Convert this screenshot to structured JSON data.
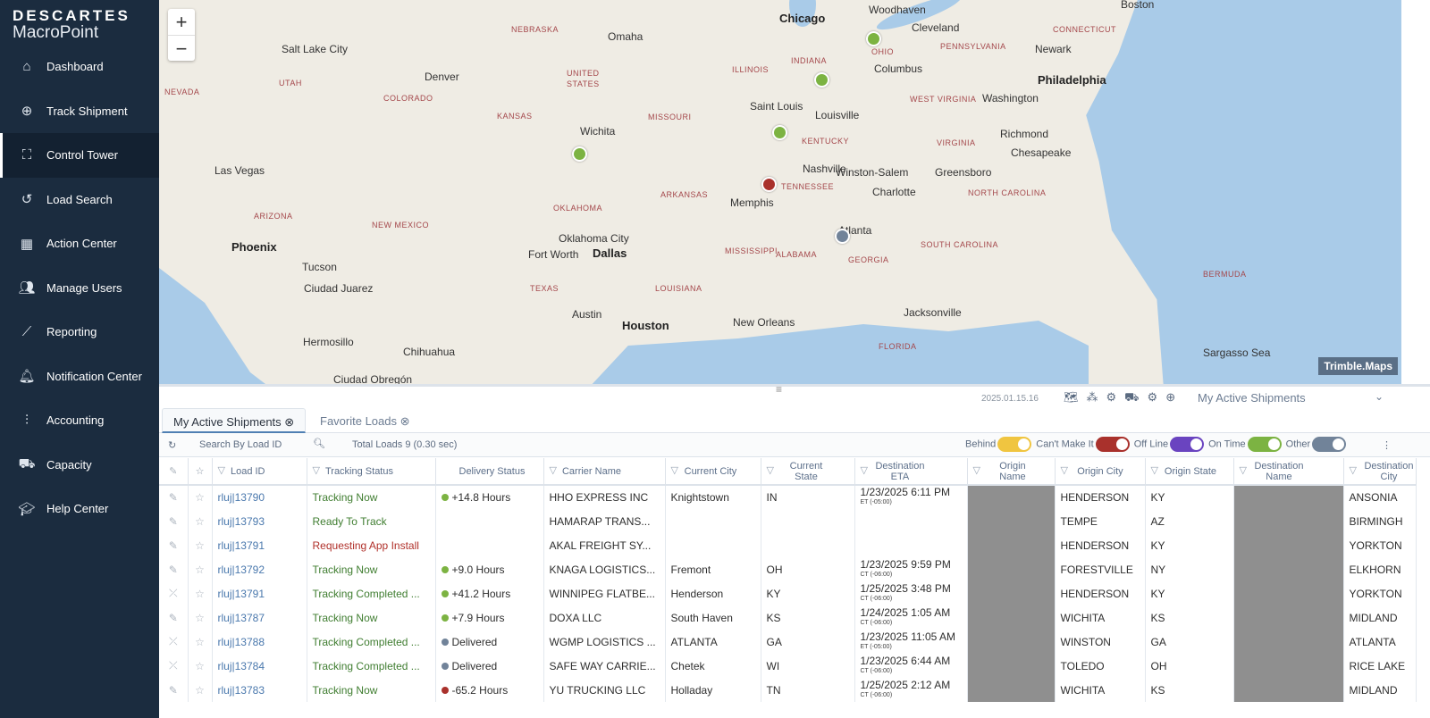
{
  "brand": {
    "line1": "DESCARTES",
    "line2": "MacroPoint"
  },
  "sidebar": {
    "items": [
      {
        "label": "Dashboard",
        "icon": "home-icon"
      },
      {
        "label": "Track Shipment",
        "icon": "plus-circle-icon"
      },
      {
        "label": "Control Tower",
        "icon": "binoculars-icon",
        "active": true
      },
      {
        "label": "Load Search",
        "icon": "history-icon"
      },
      {
        "label": "Action Center",
        "icon": "table-icon"
      },
      {
        "label": "Manage Users",
        "icon": "users-icon"
      },
      {
        "label": "Reporting",
        "icon": "chart-line-icon"
      },
      {
        "label": "Notification Center",
        "icon": "bell-icon"
      },
      {
        "label": "Accounting",
        "icon": "sliders-icon"
      },
      {
        "label": "Capacity",
        "icon": "truck-icon"
      },
      {
        "label": "Help Center",
        "icon": "graduation-cap-icon"
      }
    ]
  },
  "map": {
    "zoom_in": "+",
    "zoom_out": "−",
    "attribution": "Trimble.Maps",
    "labels": [
      "Chicago",
      "Woodhaven",
      "Cleveland",
      "Boston",
      "Columbus",
      "Philadelphia",
      "Washington",
      "Richmond",
      "Chesapeake",
      "Salt Lake City",
      "Denver",
      "Omaha",
      "UNITED",
      "STATES",
      "Wichita",
      "Saint Louis",
      "Louisville",
      "Nashville",
      "Winston-Salem",
      "Greensboro",
      "Charlotte",
      "Las Vegas",
      "Oklahoma City",
      "Memphis",
      "Atlanta",
      "Phoenix",
      "Fort Worth",
      "Dallas",
      "Tucson",
      "Ciudad Juarez",
      "Austin",
      "Houston",
      "New Orleans",
      "Jacksonville",
      "Hermosillo",
      "Chihuahua",
      "Ciudad Obregón",
      "Newark",
      "NEBRASKA",
      "KANSAS",
      "MISSOURI",
      "ILLINOIS",
      "INDIANA",
      "OHIO",
      "KENTUCKY",
      "TENNESSEE",
      "ARKANSAS",
      "OKLAHOMA",
      "TEXAS",
      "LOUISIANA",
      "MISSISSIPPI",
      "ALABAMA",
      "GEORGIA",
      "ARIZONA",
      "NEW MEXICO",
      "COLORADO",
      "UTAH",
      "NEVADA",
      "VIRGINIA",
      "WEST VIRGINIA",
      "PENNSYLVANIA",
      "NORTH CAROLINA",
      "SOUTH CAROLINA",
      "FLORIDA",
      "BERMUDA",
      "CONNECTICUT",
      "Sargasso Sea"
    ],
    "pins": [
      {
        "status": "On Time",
        "color": "#7cb342"
      },
      {
        "status": "On Time",
        "color": "#7cb342"
      },
      {
        "status": "On Time",
        "color": "#7cb342"
      },
      {
        "status": "On Time",
        "color": "#7cb342"
      },
      {
        "status": "Can't Make It",
        "color": "#a9312c"
      },
      {
        "status": "Other",
        "color": "#718399"
      }
    ]
  },
  "toolbar": {
    "version": "2025.01.15.16",
    "view_select": "My Active Shipments",
    "icons": [
      "map-icon",
      "cluster-icon",
      "gear-cog-icon",
      "truck-route-icon",
      "settings-icon",
      "zoom-in-icon"
    ]
  },
  "tabs": [
    {
      "label": "My Active Shipments",
      "active": true
    },
    {
      "label": "Favorite Loads"
    }
  ],
  "filter": {
    "search_placeholder": "Search By Load ID",
    "total": "Total Loads 9 (0.30 sec)",
    "toggles": [
      {
        "label": "Behind",
        "color": "#f0c540"
      },
      {
        "label": "Can't Make It",
        "color": "#a9312c"
      },
      {
        "label": "Off Line",
        "color": "#6a44c0"
      },
      {
        "label": "On Time",
        "color": "#7cb342"
      },
      {
        "label": "Other",
        "color": "#718399"
      }
    ]
  },
  "columns": [
    "Load ID",
    "Tracking Status",
    "Delivery Status",
    "Carrier Name",
    "Current City",
    "Current State",
    "Destination ETA",
    "Origin Name",
    "Origin City",
    "Origin State",
    "Destination Name",
    "Destination City"
  ],
  "rows": [
    {
      "id": "rluj|13790",
      "tracking": "Tracking Now",
      "tstate": "ok",
      "delivery": "+14.8 Hours",
      "dcolor": "#7cb342",
      "carrier": "HHO EXPRESS INC",
      "city": "Knightstown",
      "state": "IN",
      "eta": "1/23/2025  6:11 PM",
      "tz": "ET (-05:00)",
      "ocity": "HENDERSON",
      "ostate": "KY",
      "dcity": "ANSONIA",
      "edit": "pencil"
    },
    {
      "id": "rluj|13793",
      "tracking": "Ready To Track",
      "tstate": "ok",
      "delivery": "",
      "dcolor": "",
      "carrier": "HAMARAP TRANS...",
      "city": "",
      "state": "",
      "eta": "",
      "tz": "",
      "ocity": "TEMPE",
      "ostate": "AZ",
      "dcity": "BIRMINGH",
      "edit": "pencil"
    },
    {
      "id": "rluj|13791",
      "tracking": "Requesting App Install",
      "tstate": "bad",
      "delivery": "",
      "dcolor": "",
      "carrier": "AKAL FREIGHT SY...",
      "city": "",
      "state": "",
      "eta": "",
      "tz": "",
      "ocity": "HENDERSON",
      "ostate": "KY",
      "dcity": "YORKTON",
      "edit": "pencil"
    },
    {
      "id": "rluj|13792",
      "tracking": "Tracking Now",
      "tstate": "ok",
      "delivery": "+9.0 Hours",
      "dcolor": "#7cb342",
      "carrier": "KNAGA LOGISTICS...",
      "city": "Fremont",
      "state": "OH",
      "eta": "1/23/2025  9:59 PM",
      "tz": "CT (-06:00)",
      "ocity": "FORESTVILLE",
      "ostate": "NY",
      "dcity": "ELKHORN",
      "edit": "pencil"
    },
    {
      "id": "rluj|13791",
      "tracking": "Tracking Completed ...",
      "tstate": "ok",
      "delivery": "+41.2 Hours",
      "dcolor": "#7cb342",
      "carrier": "WINNIPEG FLATBE...",
      "city": "Henderson",
      "state": "KY",
      "eta": "1/25/2025  3:48 PM",
      "tz": "CT (-06:00)",
      "ocity": "HENDERSON",
      "ostate": "KY",
      "dcity": "YORKTON",
      "edit": "pencil-off"
    },
    {
      "id": "rluj|13787",
      "tracking": "Tracking Now",
      "tstate": "ok",
      "delivery": "+7.9 Hours",
      "dcolor": "#7cb342",
      "carrier": "DOXA LLC",
      "city": "South Haven",
      "state": "KS",
      "eta": "1/24/2025  1:05 AM",
      "tz": "CT (-06:00)",
      "ocity": "WICHITA",
      "ostate": "KS",
      "dcity": "MIDLAND",
      "edit": "pencil"
    },
    {
      "id": "rluj|13788",
      "tracking": "Tracking Completed ...",
      "tstate": "ok",
      "delivery": "Delivered",
      "dcolor": "#718399",
      "carrier": "WGMP LOGISTICS ...",
      "city": "ATLANTA",
      "state": "GA",
      "eta": "1/23/2025  11:05 AM",
      "tz": "ET (-05:00)",
      "ocity": "WINSTON",
      "ostate": "GA",
      "dcity": "ATLANTA",
      "edit": "pencil-off"
    },
    {
      "id": "rluj|13784",
      "tracking": "Tracking Completed ...",
      "tstate": "ok",
      "delivery": "Delivered",
      "dcolor": "#718399",
      "carrier": "SAFE WAY CARRIE...",
      "city": "Chetek",
      "state": "WI",
      "eta": "1/23/2025  6:44 AM",
      "tz": "CT (-06:00)",
      "ocity": "TOLEDO",
      "ostate": "OH",
      "dcity": "RICE LAKE",
      "edit": "pencil-off"
    },
    {
      "id": "rluj|13783",
      "tracking": "Tracking Now",
      "tstate": "ok",
      "delivery": "-65.2 Hours",
      "dcolor": "#a9312c",
      "carrier": "YU TRUCKING LLC",
      "city": "Holladay",
      "state": "TN",
      "eta": "1/25/2025  2:12 AM",
      "tz": "CT (-06:00)",
      "ocity": "WICHITA",
      "ostate": "KS",
      "dcity": "MIDLAND",
      "edit": "pencil"
    }
  ]
}
